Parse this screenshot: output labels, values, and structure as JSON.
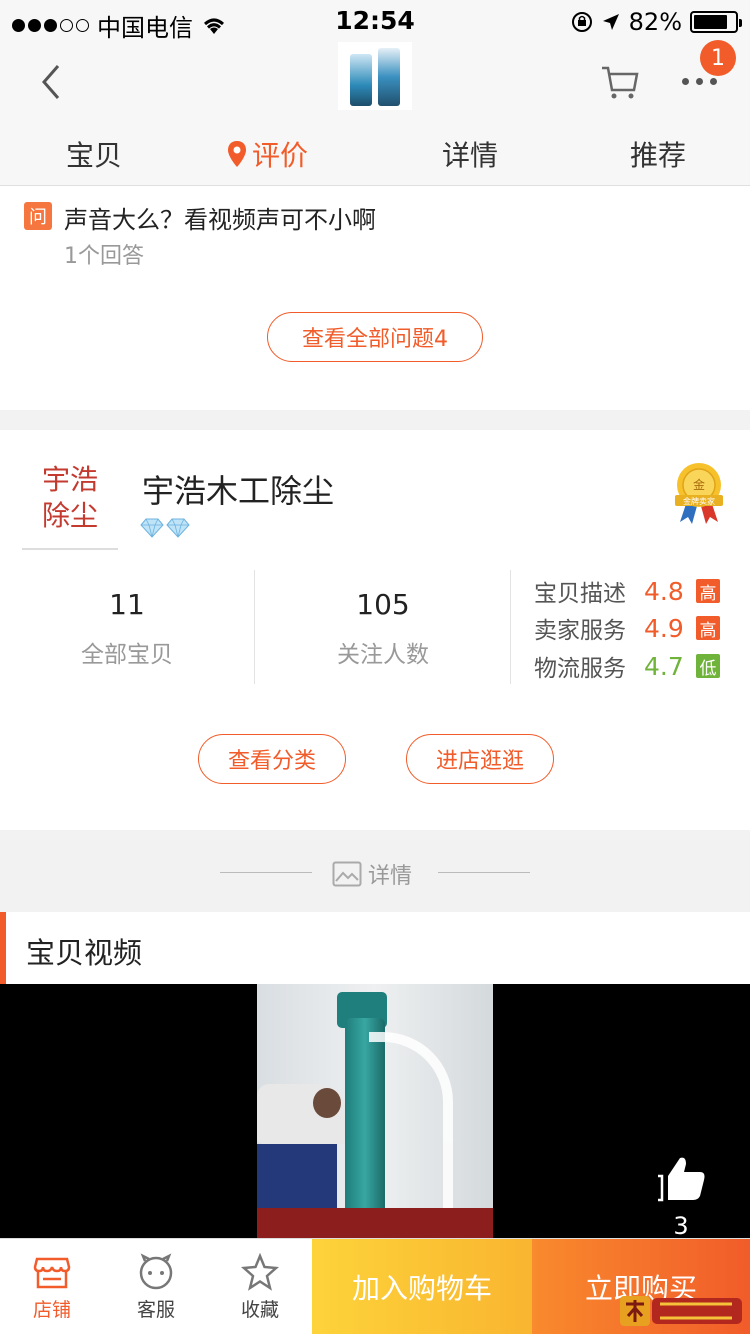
{
  "status_bar": {
    "carrier": "中国电信",
    "time": "12:54",
    "battery": "82%",
    "battery_level": 0.82
  },
  "header": {
    "cart_badge": "1",
    "tabs": [
      {
        "label": "宝贝"
      },
      {
        "label": "评价"
      },
      {
        "label": "详情"
      },
      {
        "label": "推荐"
      }
    ],
    "active_tab": "评价"
  },
  "qa": {
    "badge": "问",
    "question": "声音大么？看视频声可不小啊",
    "answers": "1个回答",
    "view_all": "查看全部问题4"
  },
  "shop": {
    "logo_text_line1": "宇浩",
    "logo_text_line2": "除尘",
    "name": "宇浩木工除尘",
    "diamonds": 2,
    "medal_top": "金",
    "medal_label": "金牌卖家",
    "stats": [
      {
        "num": "11",
        "label": "全部宝贝"
      },
      {
        "num": "105",
        "label": "关注人数"
      }
    ],
    "ratings": [
      {
        "label": "宝贝描述",
        "score": "4.8",
        "level": "高",
        "color": "#f15c2a"
      },
      {
        "label": "卖家服务",
        "score": "4.9",
        "level": "高",
        "color": "#f15c2a"
      },
      {
        "label": "物流服务",
        "score": "4.7",
        "level": "低",
        "color": "#6fb33a"
      }
    ],
    "btn_category": "查看分类",
    "btn_visit": "进店逛逛"
  },
  "details_divider": "详情",
  "video": {
    "title": "宝贝视频",
    "likes": "3"
  },
  "bottom_bar": {
    "store": "店铺",
    "service": "客服",
    "favorite": "收藏",
    "add_cart": "加入购物车",
    "buy_now": "立即购买"
  },
  "colors": {
    "accent": "#f15c2a",
    "cart_yellow": "#f9b530",
    "low_green": "#6fb33a"
  },
  "icons": [
    "back-icon",
    "cart-icon",
    "more-icon",
    "location-pin-icon",
    "diamond-icon",
    "gold-medal-icon",
    "image-icon",
    "thumbs-up-icon",
    "store-icon",
    "chat-icon",
    "star-icon"
  ]
}
